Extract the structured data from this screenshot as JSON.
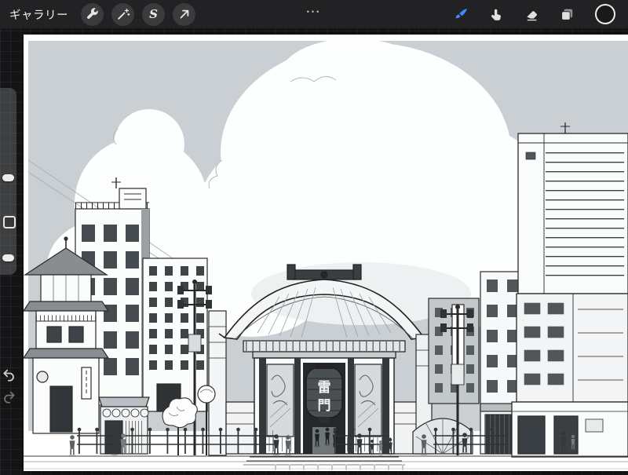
{
  "top_bar": {
    "gallery_label": "ギャラリー",
    "center_dots": "•••",
    "selection_glyph": "S",
    "left_tools": [
      "wrench-icon",
      "magic-wand-icon",
      "selection-s-icon",
      "transform-arrow-icon"
    ],
    "right_tools": [
      "paintbrush-icon",
      "smudge-finger-icon",
      "eraser-icon",
      "layers-icon",
      "color-circle-icon"
    ],
    "active_tool": "paintbrush"
  },
  "sidebar": {
    "controls": [
      "brush-size-slider",
      "modify-button",
      "opacity-slider",
      "undo-button",
      "redo-button"
    ]
  },
  "canvas": {
    "lantern_char_top": "雷",
    "lantern_char_bottom": "門"
  },
  "colors": {
    "accent_blue": "#3d8bff",
    "top_bar_bg": "#222224",
    "workspace_bg": "#151517",
    "sky": "#c9cfd3",
    "cloud": "#fdfefe",
    "line": "#2b2b2b"
  }
}
